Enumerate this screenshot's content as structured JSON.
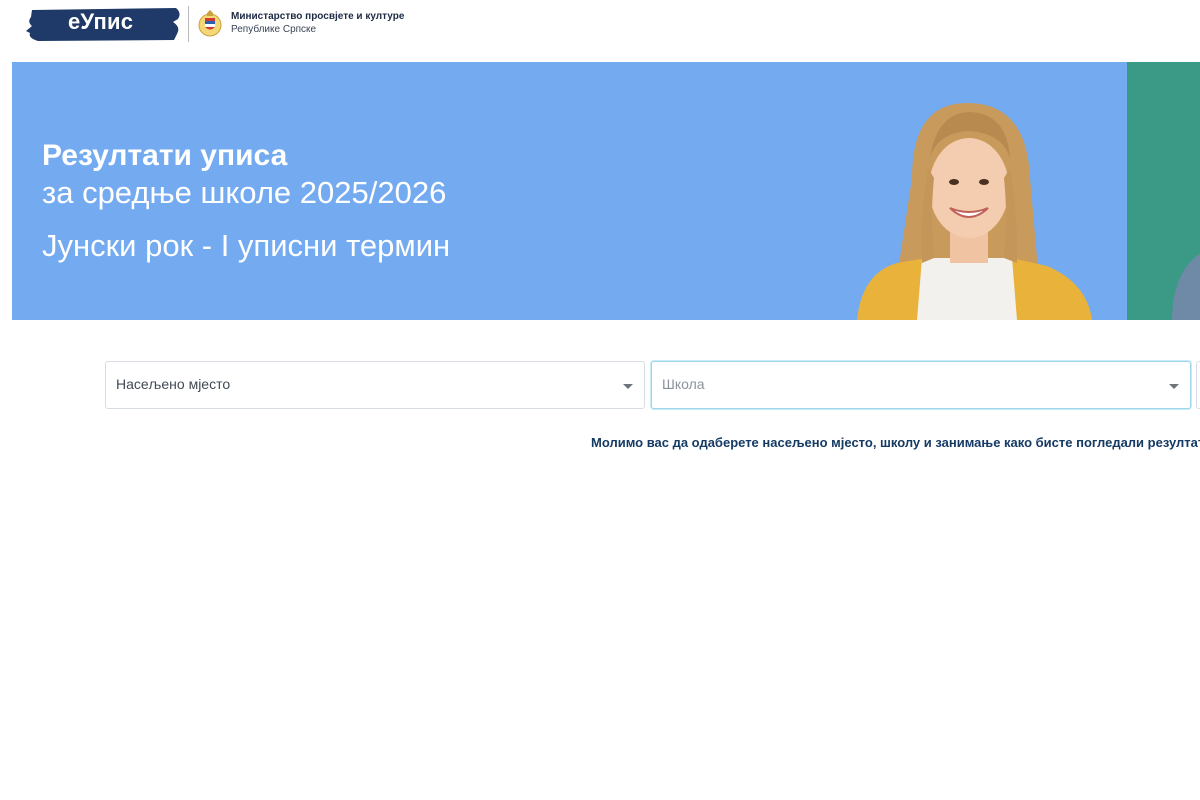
{
  "header": {
    "logo_text": "еУпис",
    "ministry_line1": "Министарство просвјете и културе",
    "ministry_line2": "Републике Српске",
    "colors": {
      "logo_brush": "#1f3a68"
    }
  },
  "banner": {
    "title": "Резултати уписа",
    "subtitle": "за средње школе 2025/2026",
    "term": "Јунски рок - I уписни термин",
    "colors": {
      "background": "#74abf0",
      "accent": "#3a9a86"
    }
  },
  "filters": {
    "settlement": {
      "value": "Насељено мјесто",
      "icon": "caret-down-icon"
    },
    "school": {
      "placeholder": "Школа",
      "icon": "caret-down-icon"
    }
  },
  "hint": "Молимо вас да одаберете насељено мјесто, школу и занимање како бисте погледали резултат"
}
